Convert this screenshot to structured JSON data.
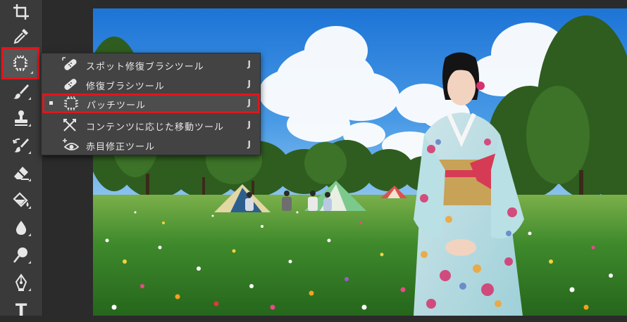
{
  "toolbar": {
    "tools": [
      {
        "name": "crop-tool",
        "icon": "crop-icon"
      },
      {
        "name": "eyedropper-tool",
        "icon": "eyedropper-icon"
      },
      {
        "name": "patch-tool",
        "icon": "patch-icon",
        "active": true
      },
      {
        "name": "brush-tool",
        "icon": "brush-icon"
      },
      {
        "name": "clone-stamp-tool",
        "icon": "stamp-icon"
      },
      {
        "name": "history-brush-tool",
        "icon": "history-brush-icon"
      },
      {
        "name": "eraser-tool",
        "icon": "eraser-icon"
      },
      {
        "name": "paint-bucket-tool",
        "icon": "paint-bucket-icon"
      },
      {
        "name": "blur-tool",
        "icon": "blur-drop-icon"
      },
      {
        "name": "dodge-tool",
        "icon": "dodge-icon"
      },
      {
        "name": "pen-tool",
        "icon": "pen-icon"
      },
      {
        "name": "type-tool",
        "icon": "type-icon"
      }
    ],
    "type_tool_glyph": "T"
  },
  "flyout": {
    "items": [
      {
        "label": "スポット修復ブラシツール",
        "shortcut": "J",
        "icon": "spot-healing-brush-icon",
        "selected": false
      },
      {
        "label": "修復ブラシツール",
        "shortcut": "J",
        "icon": "healing-brush-icon",
        "selected": false
      },
      {
        "label": "パッチツール",
        "shortcut": "J",
        "icon": "patch-icon",
        "selected": true
      },
      {
        "label": "コンテンツに応じた移動ツール",
        "shortcut": "J",
        "icon": "content-aware-move-icon",
        "selected": false
      },
      {
        "label": "赤目修正ツール",
        "shortcut": "J",
        "icon": "red-eye-icon",
        "selected": false
      }
    ]
  },
  "colors": {
    "highlight": "#e0161b",
    "toolbar_bg": "#3a3a3a",
    "menu_bg": "#434343"
  }
}
